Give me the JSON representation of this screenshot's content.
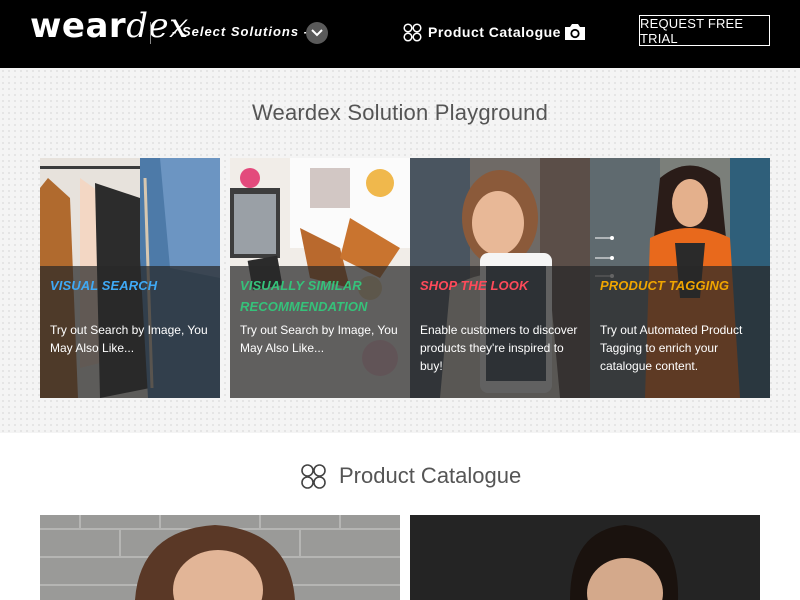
{
  "header": {
    "logo": {
      "part1": "wear",
      "part2": "dex"
    },
    "select_solutions": "- Select Solutions -",
    "catalogue_link": "Product Catalogue",
    "trial_button": "REQUEST FREE TRIAL"
  },
  "playground": {
    "title": "Weardex Solution Playground",
    "cards": [
      {
        "title": "VISUAL SEARCH",
        "description": "Try out Search by Image, You May Also Like...",
        "title_color": "#3fa9f5"
      },
      {
        "title": "VISUALLY SIMILAR RECOMMENDATION",
        "description": "Try out Search by Image, You May Also Like...",
        "title_color": "#35c27a"
      },
      {
        "title": "SHOP THE LOOK",
        "description": "Enable customers to discover products they're inspired to buy!",
        "title_color": "#ff4a5a"
      },
      {
        "title": "PRODUCT TAGGING",
        "description": "Try out Automated Product Tagging to enrich your catalogue content.",
        "title_color": "#f0a500"
      }
    ]
  },
  "catalogue": {
    "title": "Product Catalogue"
  },
  "icons": {
    "chevron": "chevron-down-icon",
    "catalogue": "four-circles-icon",
    "camera": "camera-icon"
  },
  "colors": {
    "navbar_bg": "#000000",
    "playground_bg": "#f4f4f4",
    "heading_text": "#555555"
  }
}
